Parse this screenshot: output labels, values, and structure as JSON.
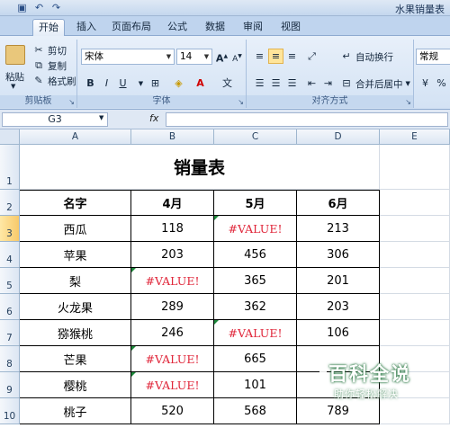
{
  "window": {
    "title": "水果销量表"
  },
  "qat": {
    "icons": [
      "save-icon",
      "undo-icon",
      "redo-icon"
    ]
  },
  "tabs": [
    "开始",
    "插入",
    "页面布局",
    "公式",
    "数据",
    "审阅",
    "视图"
  ],
  "ribbon": {
    "clipboard": {
      "paste": "粘贴",
      "cut": "剪切",
      "copy": "复制",
      "format_painter": "格式刷",
      "label": "剪贴板"
    },
    "font": {
      "name": "宋体",
      "size": "14",
      "label": "字体",
      "bold": "B",
      "italic": "I",
      "underline": "U"
    },
    "alignment": {
      "wrap": "自动换行",
      "merge": "合并后居中",
      "label": "对齐方式"
    },
    "number": {
      "format": "常规"
    }
  },
  "formula_bar": {
    "name_box": "G3",
    "fx": "fx",
    "value": ""
  },
  "columns": [
    "A",
    "B",
    "C",
    "D",
    "E"
  ],
  "rows": [
    "1",
    "2",
    "3",
    "4",
    "5",
    "6",
    "7",
    "8",
    "9",
    "10"
  ],
  "sheet": {
    "title": "销量表",
    "headers": [
      "名字",
      "4月",
      "5月",
      "6月"
    ],
    "data": [
      [
        "西瓜",
        "118",
        "#VALUE!",
        "213"
      ],
      [
        "苹果",
        "203",
        "456",
        "306"
      ],
      [
        "梨",
        "#VALUE!",
        "365",
        "201"
      ],
      [
        "火龙果",
        "289",
        "362",
        "203"
      ],
      [
        "猕猴桃",
        "246",
        "#VALUE!",
        "106"
      ],
      [
        "芒果",
        "#VALUE!",
        "665",
        ""
      ],
      [
        "樱桃",
        "#VALUE!",
        "101",
        ""
      ],
      [
        "桃子",
        "520",
        "568",
        "789"
      ]
    ]
  },
  "watermark": {
    "main": "百科全说",
    "sub": "助你轻松解决"
  }
}
